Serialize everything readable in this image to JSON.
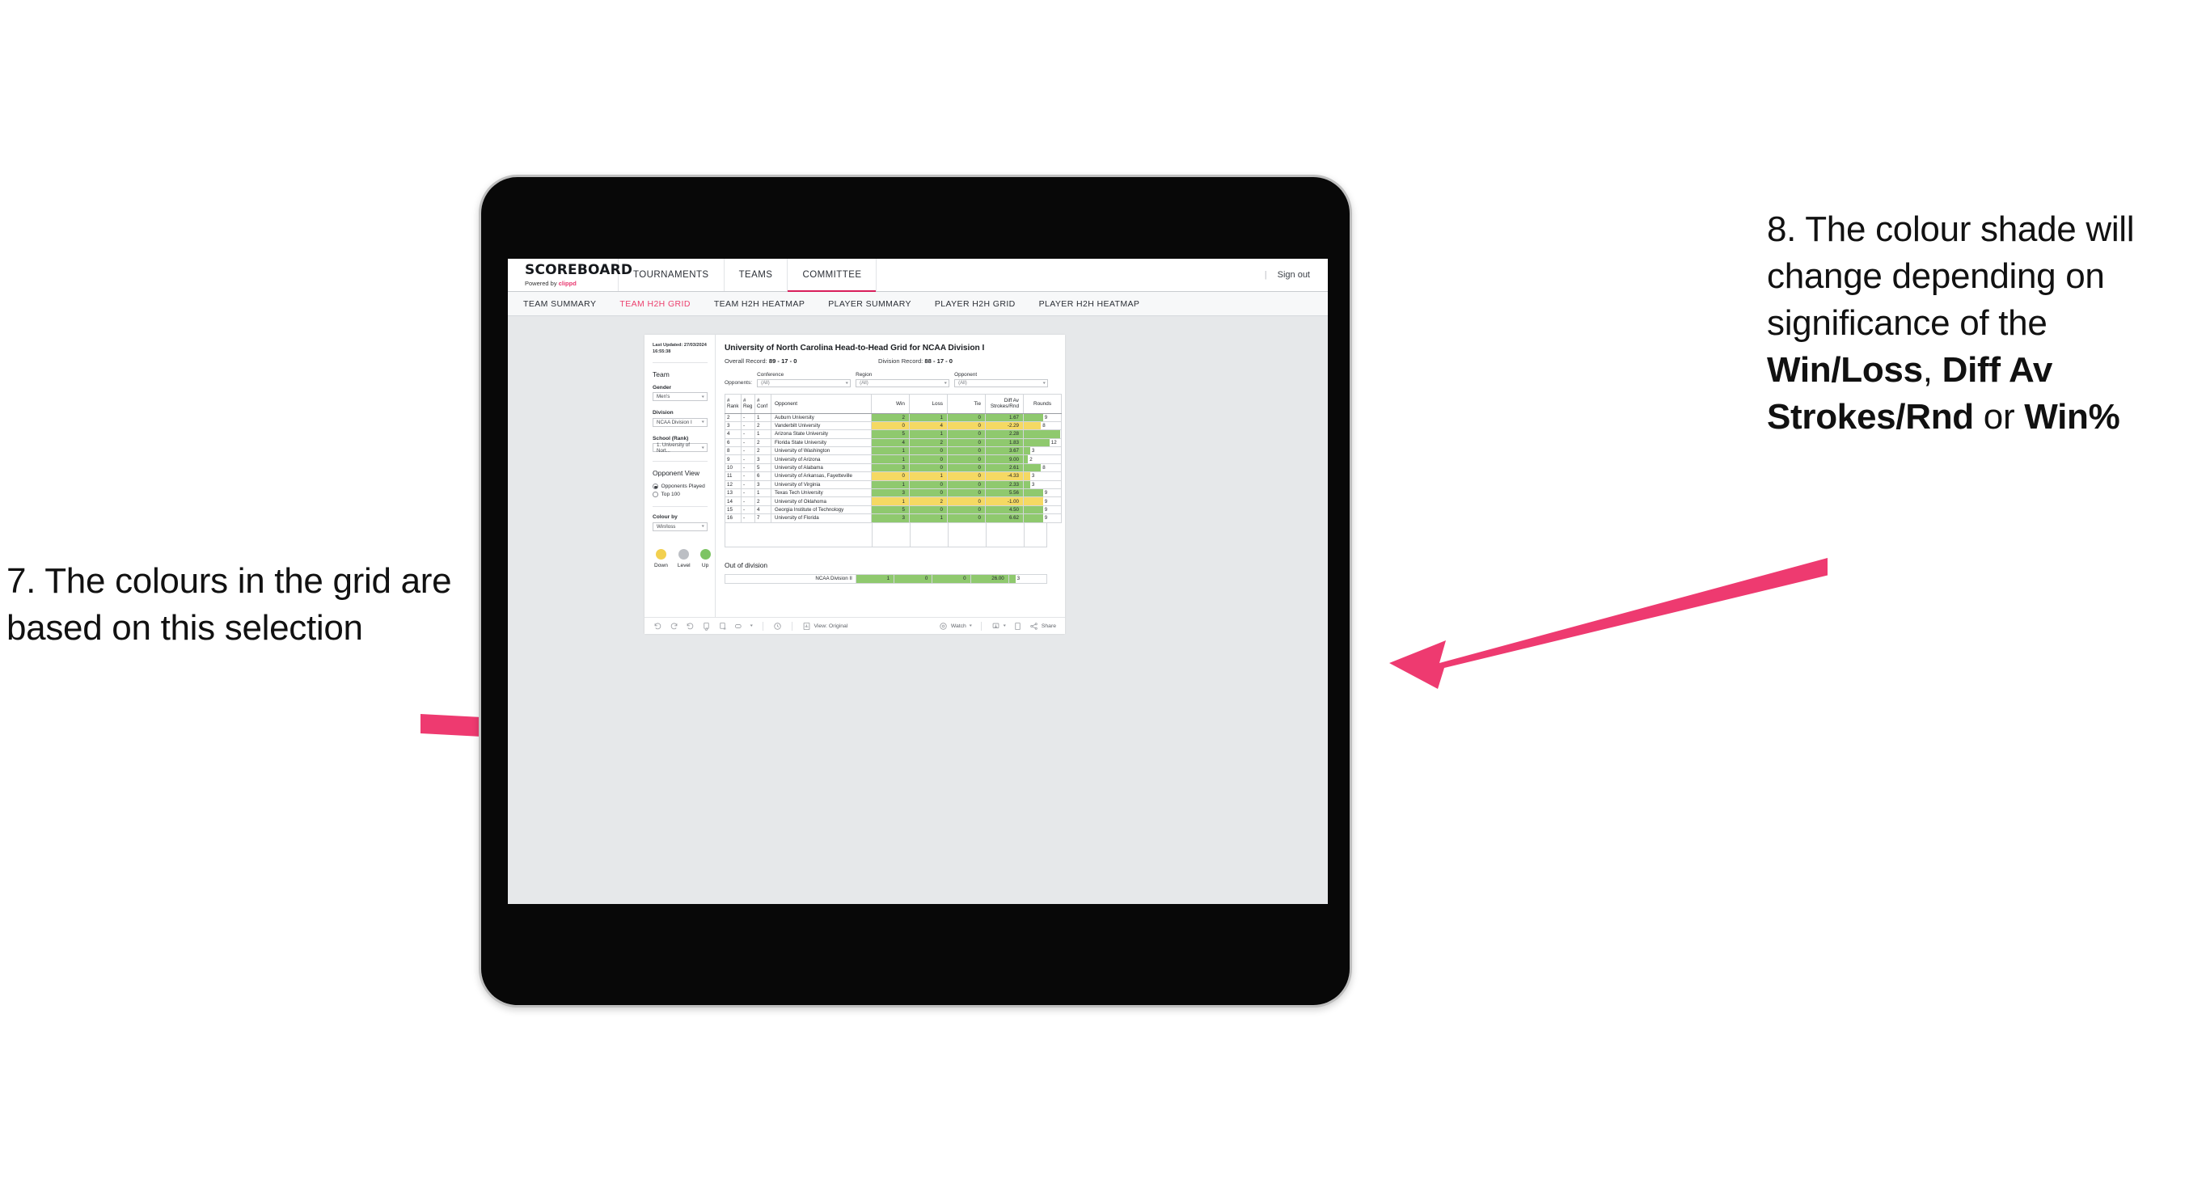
{
  "annotations": {
    "left": "7. The colours in the grid are based on this selection",
    "right_pre": "8. The colour shade will change depending on significance of the ",
    "right_b1": "Win/Loss",
    "right_mid1": ", ",
    "right_b2": "Diff Av Strokes/Rnd",
    "right_mid2": " or ",
    "right_b3": "Win%"
  },
  "topnav": {
    "brand": "SCOREBOARD",
    "brand_sub_prefix": "Powered by ",
    "brand_sub_accent": "clippd",
    "items": [
      {
        "label": "TOURNAMENTS",
        "active": false
      },
      {
        "label": "TEAMS",
        "active": false
      },
      {
        "label": "COMMITTEE",
        "active": true
      }
    ],
    "divider": "|",
    "signout": "Sign out"
  },
  "subnav": {
    "items": [
      {
        "label": "TEAM SUMMARY",
        "active": false
      },
      {
        "label": "TEAM H2H GRID",
        "active": true
      },
      {
        "label": "TEAM H2H HEATMAP",
        "active": false
      },
      {
        "label": "PLAYER SUMMARY",
        "active": false
      },
      {
        "label": "PLAYER H2H GRID",
        "active": false
      },
      {
        "label": "PLAYER H2H HEATMAP",
        "active": false
      }
    ]
  },
  "filters": {
    "last_updated": "Last Updated: 27/03/2024 16:55:38",
    "team_heading": "Team",
    "gender_label": "Gender",
    "gender_value": "Men's",
    "division_label": "Division",
    "division_value": "NCAA Division I",
    "school_label": "School (Rank)",
    "school_value": "1. University of Nort...",
    "opponent_view_heading": "Opponent View",
    "radio_opponents_played": "Opponents Played",
    "radio_top_100": "Top 100",
    "colour_by_label": "Colour by",
    "colour_by_value": "Win/loss",
    "legend": [
      {
        "label": "Down",
        "color": "#f2d04f"
      },
      {
        "label": "Level",
        "color": "#bcbfc4"
      },
      {
        "label": "Up",
        "color": "#7dc463"
      }
    ]
  },
  "content": {
    "title": "University of North Carolina Head-to-Head Grid for NCAA Division I",
    "overall_record_label": "Overall Record: ",
    "overall_record_value": "89 - 17 - 0",
    "division_record_label": "Division Record: ",
    "division_record_value": "88 - 17 - 0",
    "opponents_label": "Opponents:",
    "filter_selects": [
      {
        "label": "Conference",
        "value": "(All)"
      },
      {
        "label": "Region",
        "value": "(All)"
      },
      {
        "label": "Opponent",
        "value": "(All)"
      }
    ],
    "out_of_division_title": "Out of division"
  },
  "chart_data": {
    "type": "table",
    "title": "University of North Carolina Head-to-Head Grid for NCAA Division I",
    "columns": [
      "# Rank",
      "# Reg",
      "# Conf",
      "Opponent",
      "Win",
      "Loss",
      "Tie",
      "Diff Av Strokes/Rnd",
      "Rounds"
    ],
    "column_headers_multiline": [
      [
        "#",
        "Rank"
      ],
      [
        "#",
        "Reg"
      ],
      [
        "#",
        "Conf"
      ],
      [
        "Opponent"
      ],
      [
        "Win"
      ],
      [
        "Loss"
      ],
      [
        "Tie"
      ],
      [
        "Diff Av",
        "Strokes/Rnd"
      ],
      [
        "Rounds"
      ]
    ],
    "rounds_max": 17,
    "colors": {
      "up": "#8fc96e",
      "down": "#f5d963",
      "level": "#bcbfc4"
    },
    "rows": [
      {
        "rank": "2",
        "reg": "-",
        "conf": "1",
        "opponent": "Auburn University",
        "win": "2",
        "loss": "1",
        "tie": "0",
        "diff": "1.67",
        "rounds": "9",
        "rounds_val": 9,
        "state": "up"
      },
      {
        "rank": "3",
        "reg": "-",
        "conf": "2",
        "opponent": "Vanderbilt University",
        "win": "0",
        "loss": "4",
        "tie": "0",
        "diff": "-2.29",
        "rounds": "8",
        "rounds_val": 8,
        "state": "down"
      },
      {
        "rank": "4",
        "reg": "-",
        "conf": "1",
        "opponent": "Arizona State University",
        "win": "5",
        "loss": "1",
        "tie": "0",
        "diff": "2.28",
        "rounds": "17",
        "rounds_val": 17,
        "state": "up"
      },
      {
        "rank": "6",
        "reg": "-",
        "conf": "2",
        "opponent": "Florida State University",
        "win": "4",
        "loss": "2",
        "tie": "0",
        "diff": "1.83",
        "rounds": "12",
        "rounds_val": 12,
        "state": "up"
      },
      {
        "rank": "8",
        "reg": "-",
        "conf": "2",
        "opponent": "University of Washington",
        "win": "1",
        "loss": "0",
        "tie": "0",
        "diff": "3.67",
        "rounds": "3",
        "rounds_val": 3,
        "state": "up"
      },
      {
        "rank": "9",
        "reg": "-",
        "conf": "3",
        "opponent": "University of Arizona",
        "win": "1",
        "loss": "0",
        "tie": "0",
        "diff": "9.00",
        "rounds": "2",
        "rounds_val": 2,
        "state": "up"
      },
      {
        "rank": "10",
        "reg": "-",
        "conf": "5",
        "opponent": "University of Alabama",
        "win": "3",
        "loss": "0",
        "tie": "0",
        "diff": "2.61",
        "rounds": "8",
        "rounds_val": 8,
        "state": "up"
      },
      {
        "rank": "11",
        "reg": "-",
        "conf": "6",
        "opponent": "University of Arkansas, Fayetteville",
        "win": "0",
        "loss": "1",
        "tie": "0",
        "diff": "-4.33",
        "rounds": "3",
        "rounds_val": 3,
        "state": "down"
      },
      {
        "rank": "12",
        "reg": "-",
        "conf": "3",
        "opponent": "University of Virginia",
        "win": "1",
        "loss": "0",
        "tie": "0",
        "diff": "2.33",
        "rounds": "3",
        "rounds_val": 3,
        "state": "up"
      },
      {
        "rank": "13",
        "reg": "-",
        "conf": "1",
        "opponent": "Texas Tech University",
        "win": "3",
        "loss": "0",
        "tie": "0",
        "diff": "5.56",
        "rounds": "9",
        "rounds_val": 9,
        "state": "up"
      },
      {
        "rank": "14",
        "reg": "-",
        "conf": "2",
        "opponent": "University of Oklahoma",
        "win": "1",
        "loss": "2",
        "tie": "0",
        "diff": "-1.00",
        "rounds": "9",
        "rounds_val": 9,
        "state": "down"
      },
      {
        "rank": "15",
        "reg": "-",
        "conf": "4",
        "opponent": "Georgia Institute of Technology",
        "win": "5",
        "loss": "0",
        "tie": "0",
        "diff": "4.50",
        "rounds": "9",
        "rounds_val": 9,
        "state": "up"
      },
      {
        "rank": "16",
        "reg": "-",
        "conf": "7",
        "opponent": "University of Florida",
        "win": "3",
        "loss": "1",
        "tie": "0",
        "diff": "6.62",
        "rounds": "9",
        "rounds_val": 9,
        "state": "up"
      }
    ],
    "out_of_division_rows": [
      {
        "name": "NCAA Division II",
        "win": "1",
        "loss": "0",
        "tie": "0",
        "diff": "26.00",
        "rounds": "3",
        "rounds_val": 3,
        "state": "up"
      }
    ]
  },
  "tableau_footer": {
    "view_label": "View: Original",
    "watch_label": "Watch",
    "share_label": "Share"
  }
}
